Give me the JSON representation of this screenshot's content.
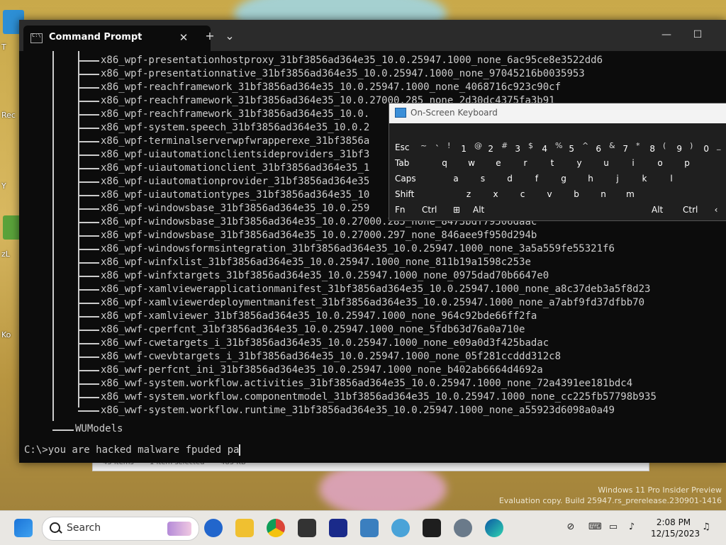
{
  "window": {
    "tab_title": "Command Prompt",
    "close_tab": "✕",
    "new_tab": "+",
    "dropdown": "⌄",
    "minimize": "—",
    "maximize": "☐"
  },
  "terminal": {
    "entries": [
      "x86_wpf-presentationhostproxy_31bf3856ad364e35_10.0.25947.1000_none_6ac95ce8e3522dd6",
      "x86_wpf-presentationnative_31bf3856ad364e35_10.0.25947.1000_none_97045216b0035953",
      "x86_wpf-reachframework_31bf3856ad364e35_10.0.25947.1000_none_4068716c923c90cf",
      "x86_wpf-reachframework_31bf3856ad364e35_10.0.27000.285_none_2d30dc4375fa3b91",
      "x86_wpf-reachframework_31bf3856ad364e35_10.0.",
      "x86_wpf-system.speech_31bf3856ad364e35_10.0.2",
      "x86_wpf-terminalserverwpfwrapperexe_31bf3856a",
      "x86_wpf-uiautomationclientsideproviders_31bf3",
      "x86_wpf-uiautomationclient_31bf3856ad364e35_1",
      "x86_wpf-uiautomationprovider_31bf3856ad364e35",
      "x86_wpf-uiautomationtypes_31bf3856ad364e35_10",
      "x86_wpf-windowsbase_31bf3856ad364e35_10.0.259",
      "x86_wpf-windowsbase_31bf3856ad364e35_10.0.27000.285_none_8473bdf79506daac",
      "x86_wpf-windowsbase_31bf3856ad364e35_10.0.27000.297_none_846aee9f950d294b",
      "x86_wpf-windowsformsintegration_31bf3856ad364e35_10.0.25947.1000_none_3a5a559fe55321f6",
      "x86_wpf-winfxlist_31bf3856ad364e35_10.0.25947.1000_none_811b19a1598c253e",
      "x86_wpf-winfxtargets_31bf3856ad364e35_10.0.25947.1000_none_0975dad70b6647e0",
      "x86_wpf-xamlviewerapplicationmanifest_31bf3856ad364e35_10.0.25947.1000_none_a8c37deb3a5f8d23",
      "x86_wpf-xamlviewerdeploymentmanifest_31bf3856ad364e35_10.0.25947.1000_none_a7abf9fd37dfbb70",
      "x86_wpf-xamlviewer_31bf3856ad364e35_10.0.25947.1000_none_964c92bde66ff2fa",
      "x86_wwf-cperfcnt_31bf3856ad364e35_10.0.25947.1000_none_5fdb63d76a0a710e",
      "x86_wwf-cwetargets_i_31bf3856ad364e35_10.0.25947.1000_none_e09a0d3f425badac",
      "x86_wwf-cwevbtargets_i_31bf3856ad364e35_10.0.25947.1000_none_05f281ccddd312c8",
      "x86_wwf-perfcnt_ini_31bf3856ad364e35_10.0.25947.1000_none_b402ab6664d4692a",
      "x86_wwf-system.workflow.activities_31bf3856ad364e35_10.0.25947.1000_none_72a4391ee181bdc4",
      "x86_wwf-system.workflow.componentmodel_31bf3856ad364e35_10.0.25947.1000_none_cc225fb57798b935",
      "x86_wwf-system.workflow.runtime_31bf3856ad364e35_10.0.25947.1000_none_a55923d6098a0a49"
    ],
    "folder": "WUModels",
    "prompt": "C:\\>",
    "command": "you are hacked malware fpuded pa"
  },
  "explorer": {
    "items": "45 items",
    "selected": "1 item selected",
    "size": "485 KB"
  },
  "keyboard": {
    "title": "On-Screen Keyboard",
    "row1": [
      {
        "label": "Esc"
      },
      {
        "top": "~",
        "main": "`"
      },
      {
        "top": "!",
        "main": "1"
      },
      {
        "top": "@",
        "main": "2"
      },
      {
        "top": "#",
        "main": "3"
      },
      {
        "top": "$",
        "main": "4"
      },
      {
        "top": "%",
        "main": "5"
      },
      {
        "top": "^",
        "main": "6"
      },
      {
        "top": "&",
        "main": "7"
      },
      {
        "top": "*",
        "main": "8"
      },
      {
        "top": "(",
        "main": "9"
      },
      {
        "top": ")",
        "main": "0"
      },
      {
        "top": "_",
        "main": "-"
      }
    ],
    "row2": [
      "Tab",
      "q",
      "w",
      "e",
      "r",
      "t",
      "y",
      "u",
      "i",
      "o",
      "p"
    ],
    "row3": [
      "Caps",
      "a",
      "s",
      "d",
      "f",
      "g",
      "h",
      "j",
      "k",
      "l"
    ],
    "row4": [
      "Shift",
      "z",
      "x",
      "c",
      "v",
      "b",
      "n",
      "m"
    ],
    "row5": [
      "Fn",
      "Ctrl",
      "Alt",
      "Alt",
      "Ctrl"
    ]
  },
  "watermark": {
    "line1": "Windows 11 Pro Insider Preview",
    "line2": "Evaluation copy. Build 25947.rs_prerelease.230901-1416"
  },
  "taskbar": {
    "search_label": "Search",
    "time": "2:08 PM",
    "date": "12/15/2023"
  },
  "desktop_labels": [
    "T",
    "Rec",
    "Y",
    "zL",
    "Ko"
  ]
}
